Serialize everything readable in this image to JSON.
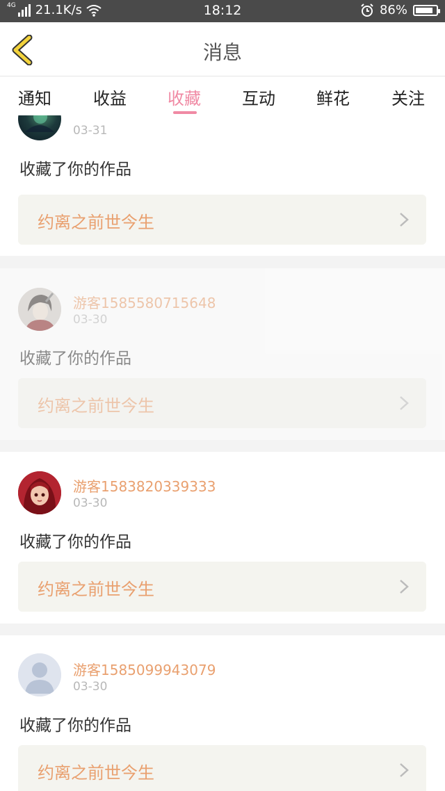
{
  "status_bar": {
    "network": "4G",
    "speed": "21.1K/s",
    "time": "18:12",
    "battery_percent": "86%",
    "battery_level": 0.86
  },
  "header": {
    "title": "消息"
  },
  "tabs": [
    {
      "label": "通知",
      "active": false
    },
    {
      "label": "收益",
      "active": false
    },
    {
      "label": "收藏",
      "active": true
    },
    {
      "label": "互动",
      "active": false
    },
    {
      "label": "鲜花",
      "active": false
    },
    {
      "label": "关注",
      "active": false
    }
  ],
  "messages": [
    {
      "user": "",
      "date": "03-31",
      "action": "收藏了你的作品",
      "work": "约离之前世今生"
    },
    {
      "user": "游客1585580715648",
      "date": "03-30",
      "action": "收藏了你的作品",
      "work": "约离之前世今生"
    },
    {
      "user": "游客1583820339333",
      "date": "03-30",
      "action": "收藏了你的作品",
      "work": "约离之前世今生"
    },
    {
      "user": "游客1585099943079",
      "date": "03-30",
      "action": "收藏了你的作品",
      "work": "约离之前世今生"
    }
  ],
  "colors": {
    "accent_pink": "#f08aa4",
    "accent_orange": "#e9a06f",
    "back_yellow": "#f3d33c"
  }
}
